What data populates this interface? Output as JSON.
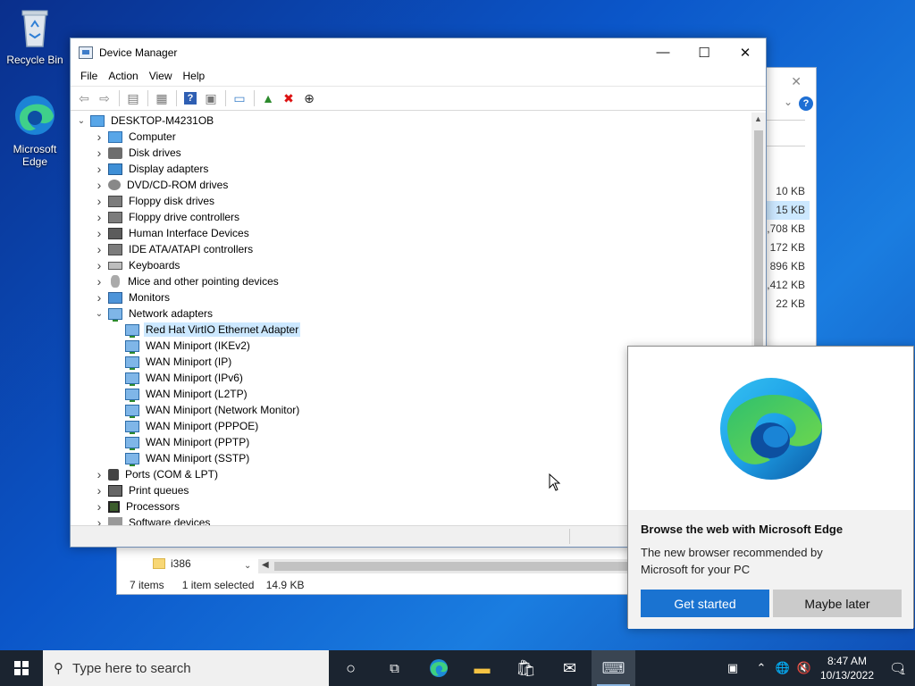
{
  "desktop": {
    "recycle_bin": "Recycle Bin",
    "edge_line1": "Microsoft",
    "edge_line2": "Edge"
  },
  "explorer": {
    "sizes": [
      "10 KB",
      "15 KB",
      ",708 KB",
      "172 KB",
      "896 KB",
      ",412 KB",
      "22 KB"
    ],
    "selected_size_index": 1,
    "folder_i386": "i386",
    "status_items": "7 items",
    "status_selected": "1 item selected",
    "status_size": "14.9 KB"
  },
  "devmgr": {
    "title": "Device Manager",
    "menu": [
      "File",
      "Action",
      "View",
      "Help"
    ],
    "root": "DESKTOP-M4231OB",
    "categories_before": [
      {
        "label": "Computer",
        "icon": "computer-icon"
      },
      {
        "label": "Disk drives",
        "icon": "disk-drive-icon"
      },
      {
        "label": "Display adapters",
        "icon": "display-adapter-icon"
      },
      {
        "label": "DVD/CD-ROM drives",
        "icon": "dvd-drive-icon"
      },
      {
        "label": "Floppy disk drives",
        "icon": "floppy-disk-icon"
      },
      {
        "label": "Floppy drive controllers",
        "icon": "floppy-controller-icon"
      },
      {
        "label": "Human Interface Devices",
        "icon": "hid-icon"
      },
      {
        "label": "IDE ATA/ATAPI controllers",
        "icon": "ide-controller-icon"
      },
      {
        "label": "Keyboards",
        "icon": "keyboard-icon"
      },
      {
        "label": "Mice and other pointing devices",
        "icon": "mouse-icon"
      },
      {
        "label": "Monitors",
        "icon": "monitor-icon"
      }
    ],
    "network_adapters": {
      "label": "Network adapters",
      "children": [
        "Red Hat VirtIO Ethernet Adapter",
        "WAN Miniport (IKEv2)",
        "WAN Miniport (IP)",
        "WAN Miniport (IPv6)",
        "WAN Miniport (L2TP)",
        "WAN Miniport (Network Monitor)",
        "WAN Miniport (PPPOE)",
        "WAN Miniport (PPTP)",
        "WAN Miniport (SSTP)"
      ],
      "selected_index": 0
    },
    "categories_after": [
      {
        "label": "Ports (COM & LPT)",
        "icon": "port-icon"
      },
      {
        "label": "Print queues",
        "icon": "printer-icon"
      },
      {
        "label": "Processors",
        "icon": "processor-icon"
      },
      {
        "label": "Software devices",
        "icon": "software-device-icon"
      }
    ]
  },
  "edge_popup": {
    "headline": "Browse the web with Microsoft Edge",
    "body": "The new browser recommended by Microsoft for your PC",
    "primary": "Get started",
    "secondary": "Maybe later"
  },
  "taskbar": {
    "search_placeholder": "Type here to search",
    "time": "8:47 AM",
    "date": "10/13/2022",
    "notification_count": "1"
  }
}
